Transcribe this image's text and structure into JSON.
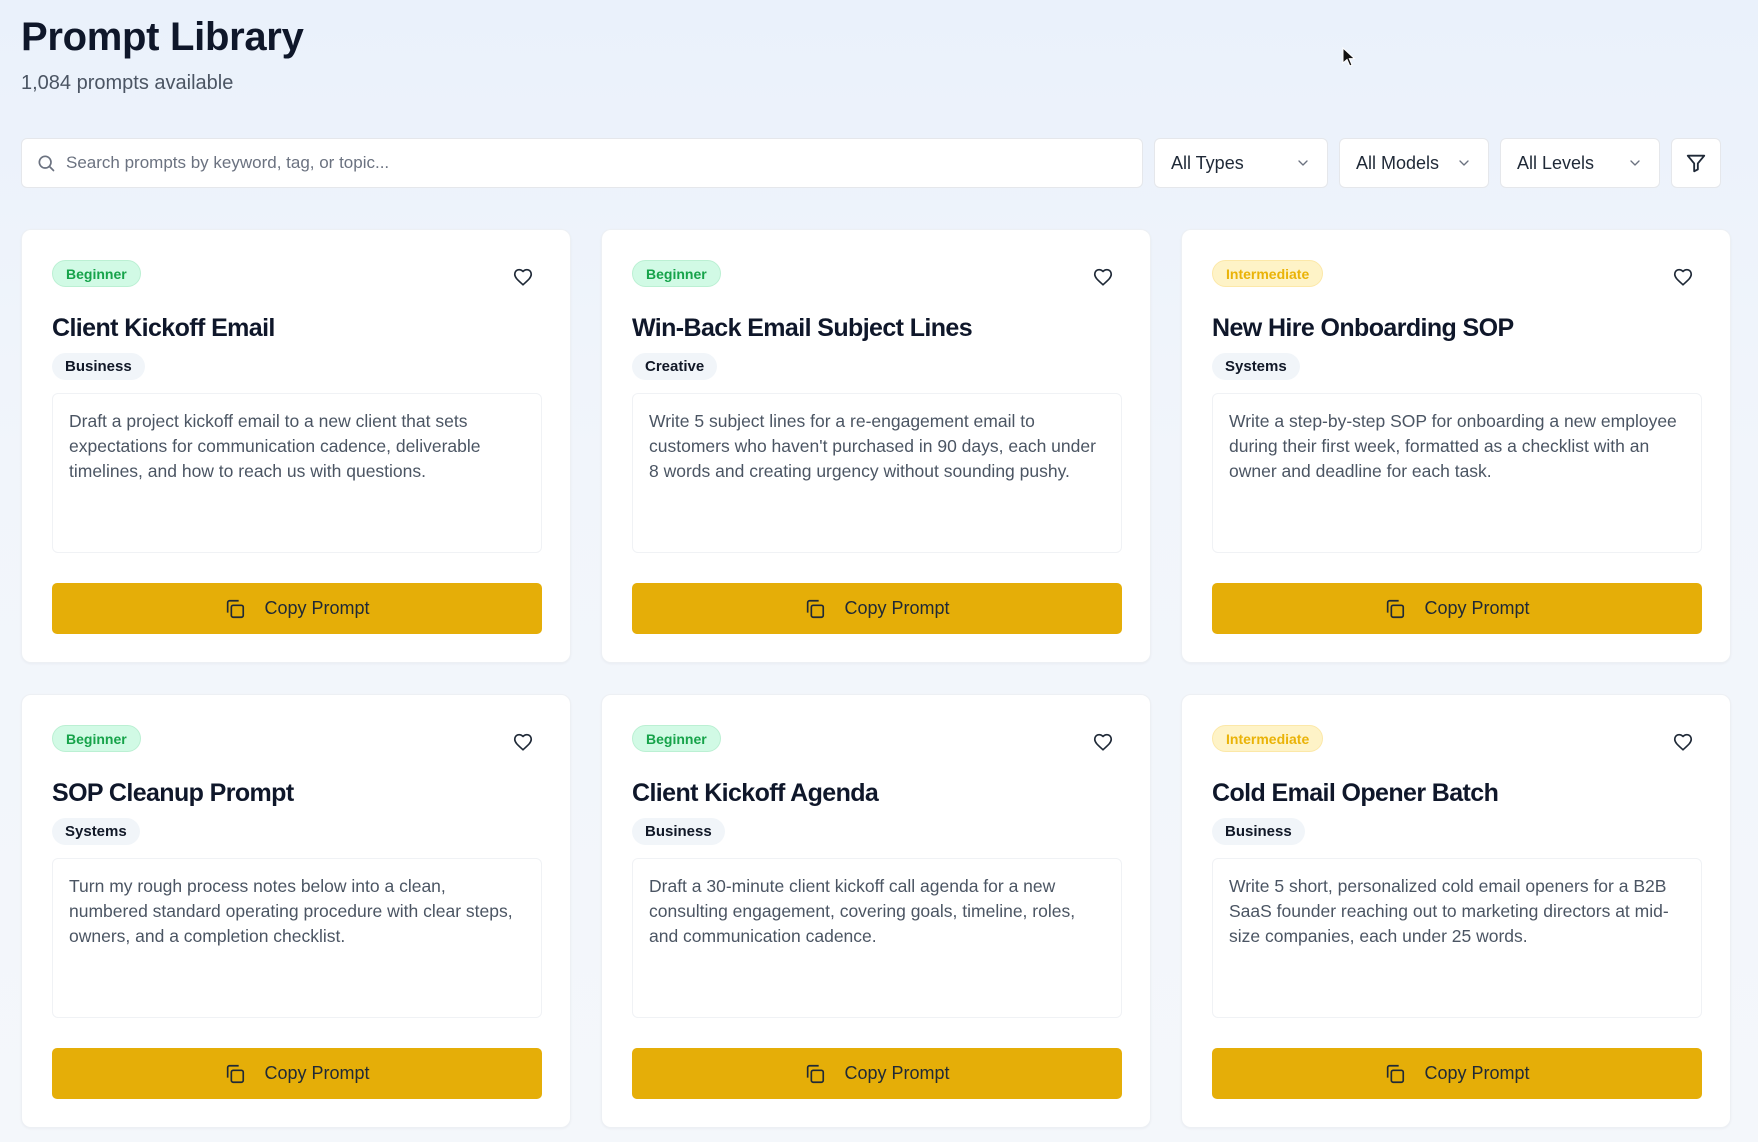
{
  "header": {
    "title": "Prompt Library",
    "subtitle": "1,084 prompts available"
  },
  "search": {
    "placeholder": "Search prompts by keyword, tag, or topic..."
  },
  "filters": {
    "type": "All Types",
    "model": "All Models",
    "level": "All Levels"
  },
  "colors": {
    "accent": "#e5ae08",
    "beginner_bg": "#d1fae5",
    "beginner_text": "#16a34a",
    "intermediate_bg": "#fef3c7",
    "intermediate_text": "#eab308"
  },
  "cards": [
    {
      "level": "Beginner",
      "title": "Client Kickoff Email",
      "category": "Business",
      "description": "Draft a project kickoff email to a new client that sets expectations for communication cadence, deliverable timelines, and how to reach us with questions.",
      "button": "Copy Prompt"
    },
    {
      "level": "Beginner",
      "title": "Win-Back Email Subject Lines",
      "category": "Creative",
      "description": "Write 5 subject lines for a re-engagement email to customers who haven't purchased in 90 days, each under 8 words and creating urgency without sounding pushy.",
      "button": "Copy Prompt"
    },
    {
      "level": "Intermediate",
      "title": "New Hire Onboarding SOP",
      "category": "Systems",
      "description": "Write a step-by-step SOP for onboarding a new employee during their first week, formatted as a checklist with an owner and deadline for each task.",
      "button": "Copy Prompt"
    },
    {
      "level": "Beginner",
      "title": "SOP Cleanup Prompt",
      "category": "Systems",
      "description": "Turn my rough process notes below into a clean, numbered standard operating procedure with clear steps, owners, and a completion checklist.",
      "button": "Copy Prompt"
    },
    {
      "level": "Beginner",
      "title": "Client Kickoff Agenda",
      "category": "Business",
      "description": "Draft a 30-minute client kickoff call agenda for a new consulting engagement, covering goals, timeline, roles, and communication cadence.",
      "button": "Copy Prompt"
    },
    {
      "level": "Intermediate",
      "title": "Cold Email Opener Batch",
      "category": "Business",
      "description": "Write 5 short, personalized cold email openers for a B2B SaaS founder reaching out to marketing directors at mid-size companies, each under 25 words.",
      "button": "Copy Prompt"
    }
  ]
}
